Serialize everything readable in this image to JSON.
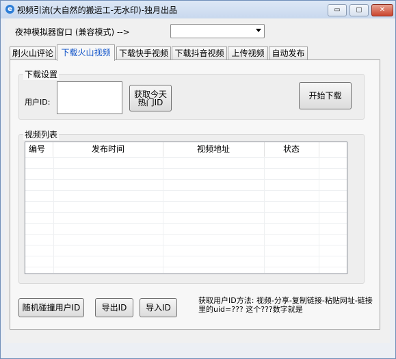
{
  "window": {
    "title": "视频引流(大自然的搬运工-无水印)-独月出品",
    "controls": {
      "minimize": "▭",
      "maximize": "▢",
      "close": "✕"
    }
  },
  "emulator": {
    "label": "夜神模拟器窗口 (兼容模式) -->",
    "selected": ""
  },
  "tabs": [
    "刷火山评论",
    "下载火山视频",
    "下载快手视频",
    "下载抖音视频",
    "上传视频",
    "自动发布"
  ],
  "active_tab": "下载火山视频",
  "download_settings": {
    "title": "下载设置",
    "user_id_label": "用户ID:",
    "user_id_value": "",
    "get_hot_id_label": "获取今天\n热门ID",
    "start_download_label": "开始下载"
  },
  "video_list": {
    "title": "视频列表",
    "columns": [
      "编号",
      "发布时间",
      "视频地址",
      "状态"
    ],
    "rows": []
  },
  "bottom": {
    "random_collide_label": "随机碰撞用户ID",
    "export_label": "导出ID",
    "import_label": "导入ID",
    "tip_text": "获取用户ID方法: 视频-分享-复制链接-粘贴网址-链接里的uid=???  这个???数字就是"
  }
}
